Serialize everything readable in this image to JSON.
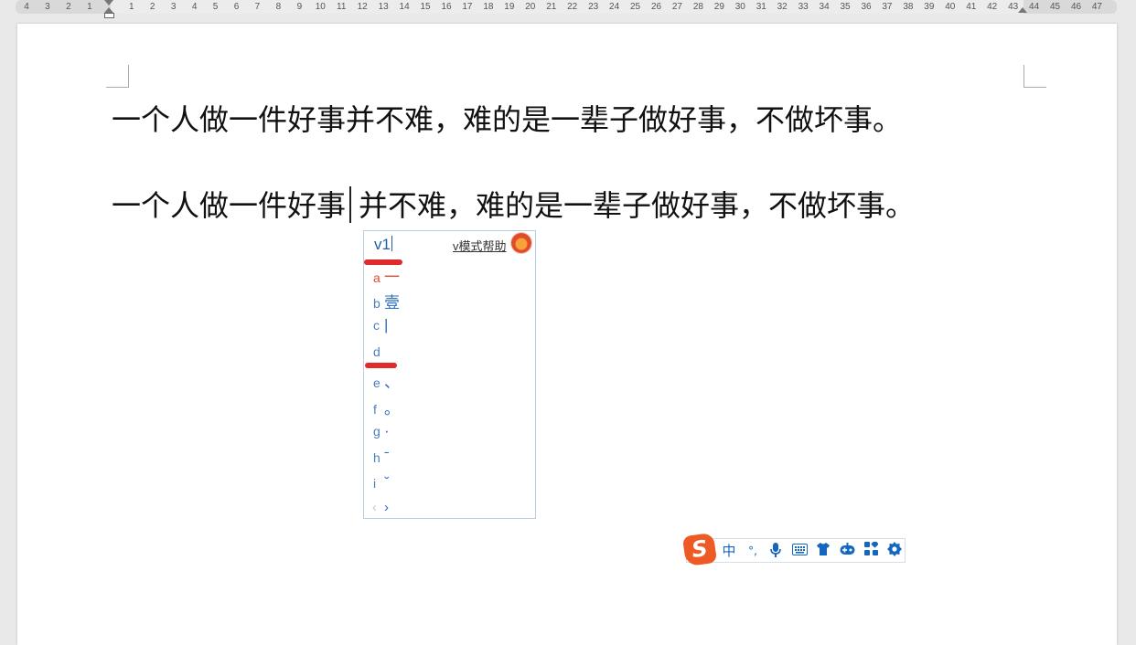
{
  "ruler": {
    "ticks": [
      "4",
      "3",
      "2",
      "1",
      "",
      "1",
      "2",
      "3",
      "4",
      "5",
      "6",
      "7",
      "8",
      "9",
      "10",
      "11",
      "12",
      "13",
      "14",
      "15",
      "16",
      "17",
      "18",
      "19",
      "20",
      "21",
      "22",
      "23",
      "24",
      "25",
      "26",
      "27",
      "28",
      "29",
      "30",
      "31",
      "32",
      "33",
      "34",
      "35",
      "36",
      "37",
      "38",
      "39",
      "40",
      "41",
      "42",
      "43",
      "44",
      "45",
      "46",
      "47"
    ]
  },
  "document": {
    "paragraph1": "一个人做一件好事并不难，难的是一辈子做好事，不做坏事。",
    "paragraph2_before_caret": "一个人做一件好事",
    "paragraph2_after_caret": "并不难，难的是一辈子做好事，不做坏事。"
  },
  "ime": {
    "input_text": "v1",
    "help_link": "v模式帮助",
    "candidates": [
      {
        "key": "a",
        "value": "一"
      },
      {
        "key": "b",
        "value": "壹"
      },
      {
        "key": "c",
        "value": "|"
      },
      {
        "key": "d",
        "value": ""
      },
      {
        "key": "e",
        "value": "、"
      },
      {
        "key": "f",
        "value": "。"
      },
      {
        "key": "g",
        "value": "·"
      },
      {
        "key": "h",
        "value": "ˉ"
      },
      {
        "key": "i",
        "value": "ˇ"
      }
    ],
    "prev_label": "‹",
    "next_label": "›",
    "annotation_color": "#e02b2b"
  },
  "toolbar": {
    "logo": "S",
    "mode_label": "中",
    "punct_label": "°,",
    "icons": [
      "mic-icon",
      "keyboard-icon",
      "skin-icon",
      "game-icon",
      "apps-icon",
      "settings-icon"
    ],
    "accent": "#1466c0",
    "logo_color": "#ee5a24"
  }
}
